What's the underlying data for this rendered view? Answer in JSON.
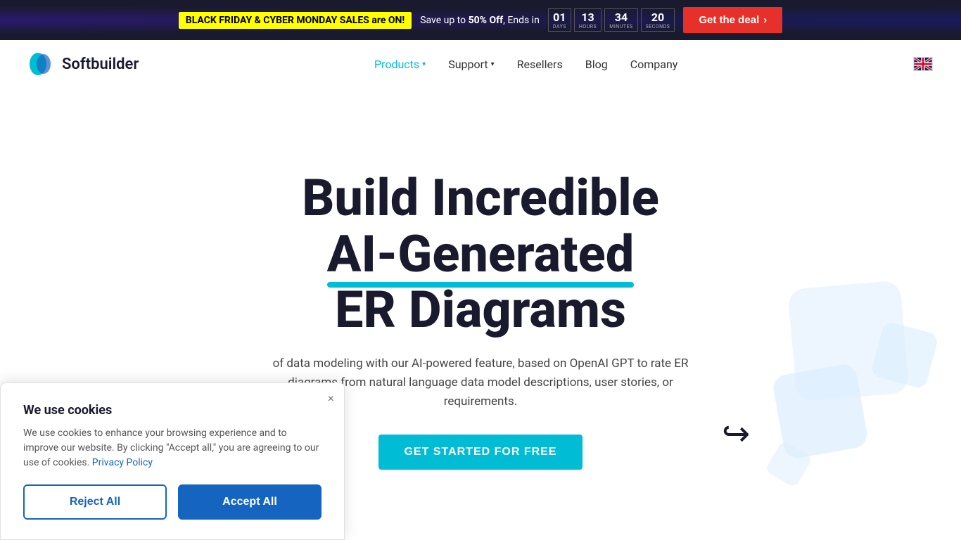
{
  "banner": {
    "highlight_text": "BLACK FRIDAY & CYBER MONDAY SALES are ON!",
    "save_text": "Save up to ",
    "discount": "50% Off",
    "ends_text": ", Ends in",
    "countdown": [
      {
        "value": "01",
        "label": "DAYS"
      },
      {
        "value": "13",
        "label": "HOURS"
      },
      {
        "value": "34",
        "label": "MINUTES"
      },
      {
        "value": "20",
        "label": "SECONDS"
      }
    ],
    "cta_label": "Get the deal",
    "cta_arrow": "›"
  },
  "navbar": {
    "logo_text": "Softbuilder",
    "nav_items": [
      {
        "label": "Products",
        "active": true,
        "has_dropdown": true
      },
      {
        "label": "Support",
        "active": false,
        "has_dropdown": true
      },
      {
        "label": "Resellers",
        "active": false,
        "has_dropdown": false
      },
      {
        "label": "Blog",
        "active": false,
        "has_dropdown": false
      },
      {
        "label": "Company",
        "active": false,
        "has_dropdown": false
      }
    ]
  },
  "hero": {
    "title_line1": "Build Incredible",
    "title_line2": "AI-Generated",
    "title_line3": "ER Diagrams",
    "subtitle": "of data modeling with our AI-powered feature, based on OpenAI GPT to rate ER diagrams from natural language data model descriptions, user stories, or requirements.",
    "cta_label": "GET STARTED FOR FREE"
  },
  "cookie": {
    "title": "We use cookies",
    "description": "We use cookies to enhance your browsing experience and to improve our website. By clicking \"Accept all,\" you are agreeing to our use of cookies.",
    "privacy_link_text": "Privacy Policy",
    "reject_label": "Reject All",
    "accept_label": "Accept All",
    "close_icon": "×"
  }
}
